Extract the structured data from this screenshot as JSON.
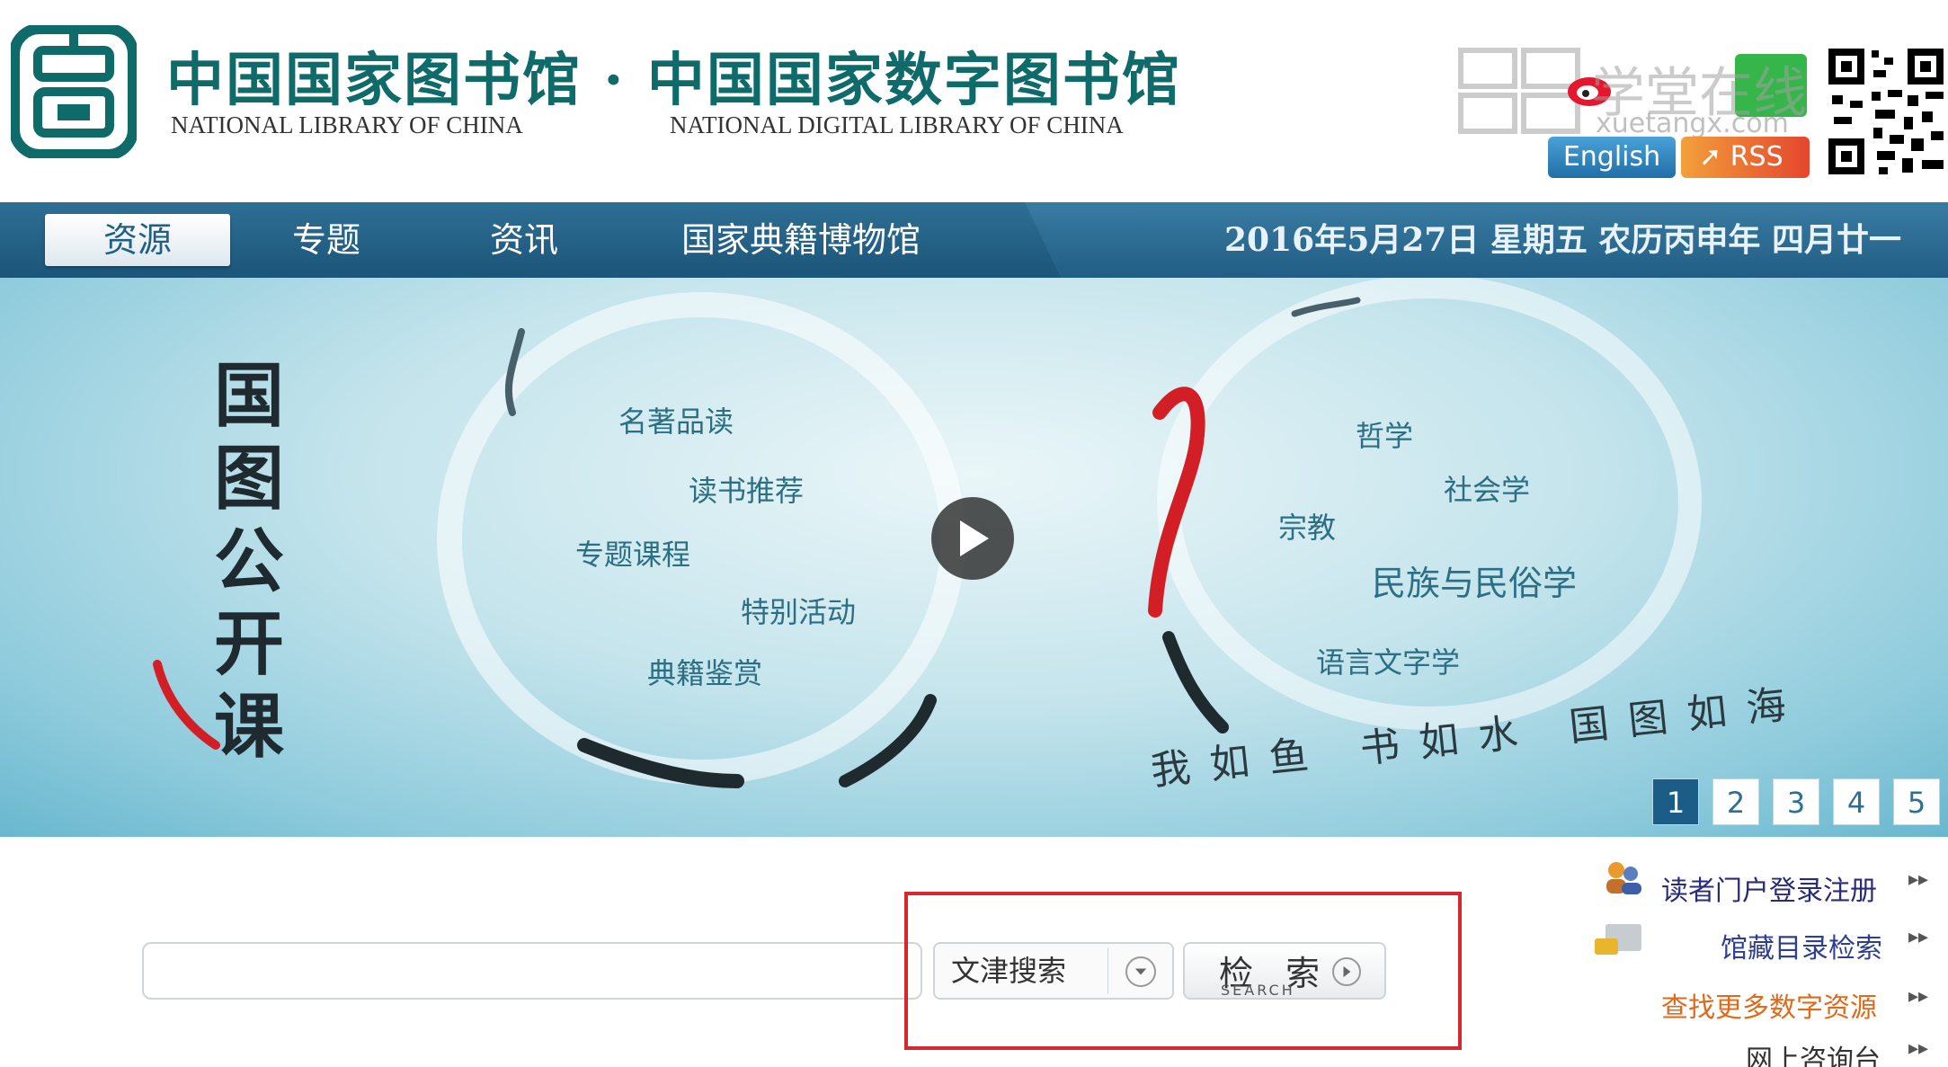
{
  "header": {
    "title_cn": "中国国家图书馆 · 中国国家数字图书馆",
    "title_en_1": "NATIONAL LIBRARY OF CHINA",
    "title_en_2": "NATIONAL DIGITAL  LIBRARY OF CHINA",
    "english_label": "English",
    "rss_label": "RSS"
  },
  "watermark": {
    "text": "学堂在线",
    "url": "xuetangx.com"
  },
  "nav": {
    "items": [
      "资源",
      "专题",
      "资讯",
      "国家典籍博物馆"
    ],
    "active": "资源",
    "date": "2016年5月27日  星期五  农历丙申年  四月廿一"
  },
  "banner": {
    "title": "国图公开课",
    "left_topics": [
      "名著品读",
      "读书推荐",
      "专题课程",
      "特别活动",
      "典籍鉴赏"
    ],
    "right_topics": [
      "哲学",
      "社会学",
      "宗教",
      "民族与民俗学",
      "语言文字学"
    ],
    "slogan": "我如鱼 书如水 国图如海",
    "pages": [
      "1",
      "2",
      "3",
      "4",
      "5"
    ],
    "active_page": "1"
  },
  "search": {
    "input_value": "",
    "scope_label": "文津搜索",
    "button_cn": "检 索",
    "button_en": "SEARCH"
  },
  "side_links": [
    {
      "label": "读者门户登录注册",
      "color": "#2a2a7a"
    },
    {
      "label": "馆藏目录检索",
      "color": "#2f3f8f"
    },
    {
      "label": "查找更多数字资源",
      "color": "#e06a1a"
    },
    {
      "label": "网上咨询台",
      "color": "#333333"
    }
  ],
  "colors": {
    "brand_teal": "#0e6b6a",
    "nav_blue": "#1b5579",
    "highlight_red": "#d8282e"
  }
}
